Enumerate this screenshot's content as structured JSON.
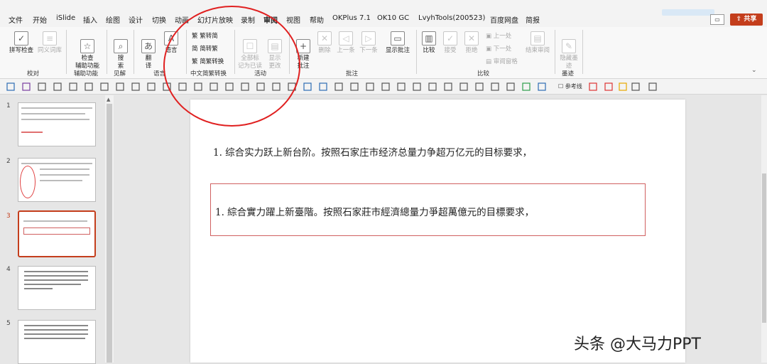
{
  "menu": {
    "items": [
      "文件",
      "开始",
      "iSlide",
      "插入",
      "绘图",
      "设计",
      "切换",
      "动画",
      "幻灯片放映",
      "录制",
      "审阅",
      "视图",
      "帮助",
      "OKPlus 7.1",
      "OK10 GC",
      "LvyhTools(200523)",
      "百度网盘",
      "简报"
    ],
    "active": "审阅",
    "share_label": "共享"
  },
  "ribbon": {
    "proofing": {
      "spell": "拼写检查",
      "thesaurus": "同义词库",
      "label": "校对"
    },
    "accessibility": {
      "check": "检查\n辅助功能",
      "label": "辅助功能"
    },
    "insights": {
      "search": "搜\n索",
      "label": "见解"
    },
    "language": {
      "translate": "翻\n译",
      "lang": "语言",
      "label": "语言"
    },
    "chinese_conversion": {
      "t2s": "繁转简",
      "s2t": "简转繁",
      "convert": "简繁转换",
      "label": "中文简繁转换"
    },
    "activity": {
      "mark_read": "全部标\n记为已读",
      "show_changes": "显示\n更改",
      "label": "活动"
    },
    "comments": {
      "new": "新建\n批注",
      "delete": "删除",
      "prev": "上一条",
      "next": "下一条",
      "show": "显示批注",
      "label": "批注"
    },
    "compare": {
      "compare": "比较",
      "accept": "接受",
      "reject": "拒绝",
      "prev": "上一处",
      "next": "下一处",
      "pane": "审阅窗格",
      "end": "结束审阅",
      "label": "比较"
    },
    "ink": {
      "hide": "隐藏墨\n迹",
      "label": "墨迹"
    }
  },
  "qat": {
    "guides_label": "参考线"
  },
  "thumbnails": {
    "numbers": [
      "1",
      "2",
      "3",
      "4",
      "5"
    ],
    "current": 3
  },
  "slide": {
    "line_simplified": "1. 综合实力跃上新台阶。按照石家庄市经济总量力争超万亿元的目标要求，",
    "line_traditional": "1. 綜合實力躍上新臺階。按照石家莊市經濟總量力爭超萬億元的目標要求，"
  },
  "watermark": "头条 @大马力PPT",
  "colors": {
    "accent": "#c43e1c",
    "annotation": "#e02020"
  }
}
